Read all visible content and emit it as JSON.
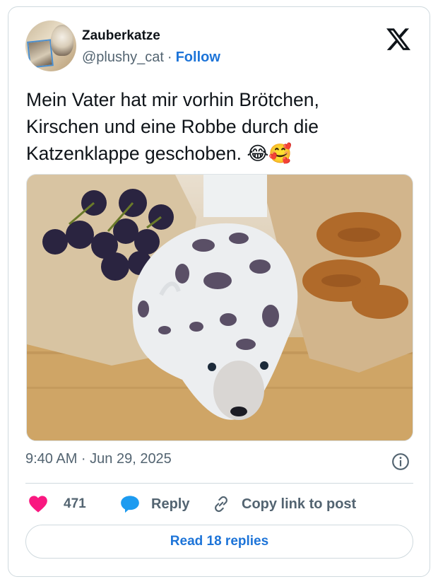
{
  "author": {
    "name": "Zauberkatze",
    "handle": "@plushy_cat",
    "separator": "·",
    "follow_label": "Follow"
  },
  "tweet": {
    "text": "Mein Vater hat mir vorhin Brötchen,\nKirschen und eine Robbe durch die\nKatzenklappe geschoben. 😂🥰",
    "timestamp": "9:40 AM · Jun 29, 2025"
  },
  "engagement": {
    "like_count": "471",
    "reply_label": "Reply",
    "copy_link_label": "Copy link to post"
  },
  "read_replies_label": "Read 18 replies",
  "colors": {
    "like_heart": "#f91880",
    "reply_bubble": "#1d9bf0",
    "accent_link": "#1d74d8",
    "secondary_text": "#536471",
    "border": "#cfd9de"
  },
  "icons": [
    "x-logo-icon",
    "info-icon",
    "heart-icon",
    "reply-bubble-icon",
    "link-icon"
  ]
}
